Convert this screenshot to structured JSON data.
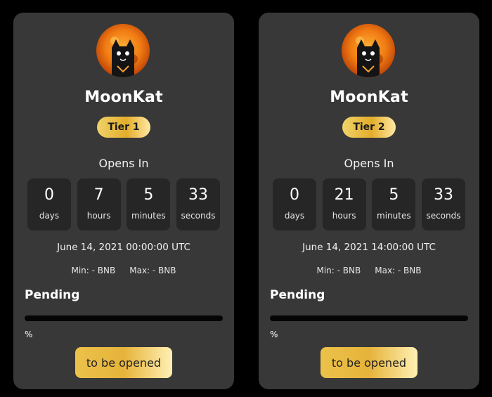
{
  "cards": [
    {
      "name": "MoonKat",
      "tier": "Tier 1",
      "opens_label": "Opens In",
      "countdown": [
        {
          "value": "0",
          "unit": "days"
        },
        {
          "value": "7",
          "unit": "hours"
        },
        {
          "value": "5",
          "unit": "minutes"
        },
        {
          "value": "33",
          "unit": "seconds"
        }
      ],
      "date": "June 14, 2021 00:00:00 UTC",
      "min": "Min: - BNB",
      "max": "Max: - BNB",
      "status": "Pending",
      "progress_percent": 0,
      "percent_text": "%",
      "button": "to be opened"
    },
    {
      "name": "MoonKat",
      "tier": "Tier 2",
      "opens_label": "Opens In",
      "countdown": [
        {
          "value": "0",
          "unit": "days"
        },
        {
          "value": "21",
          "unit": "hours"
        },
        {
          "value": "5",
          "unit": "minutes"
        },
        {
          "value": "33",
          "unit": "seconds"
        }
      ],
      "date": "June 14, 2021 14:00:00 UTC",
      "min": "Min: - BNB",
      "max": "Max: - BNB",
      "status": "Pending",
      "progress_percent": 0,
      "percent_text": "%",
      "button": "to be opened"
    }
  ],
  "colors": {
    "background": "#000000",
    "card": "#383838",
    "cell": "#262626",
    "accent_gold": "#e3ad2b"
  },
  "icons": {
    "avatar": "moonkat-cat-moon-logo"
  }
}
